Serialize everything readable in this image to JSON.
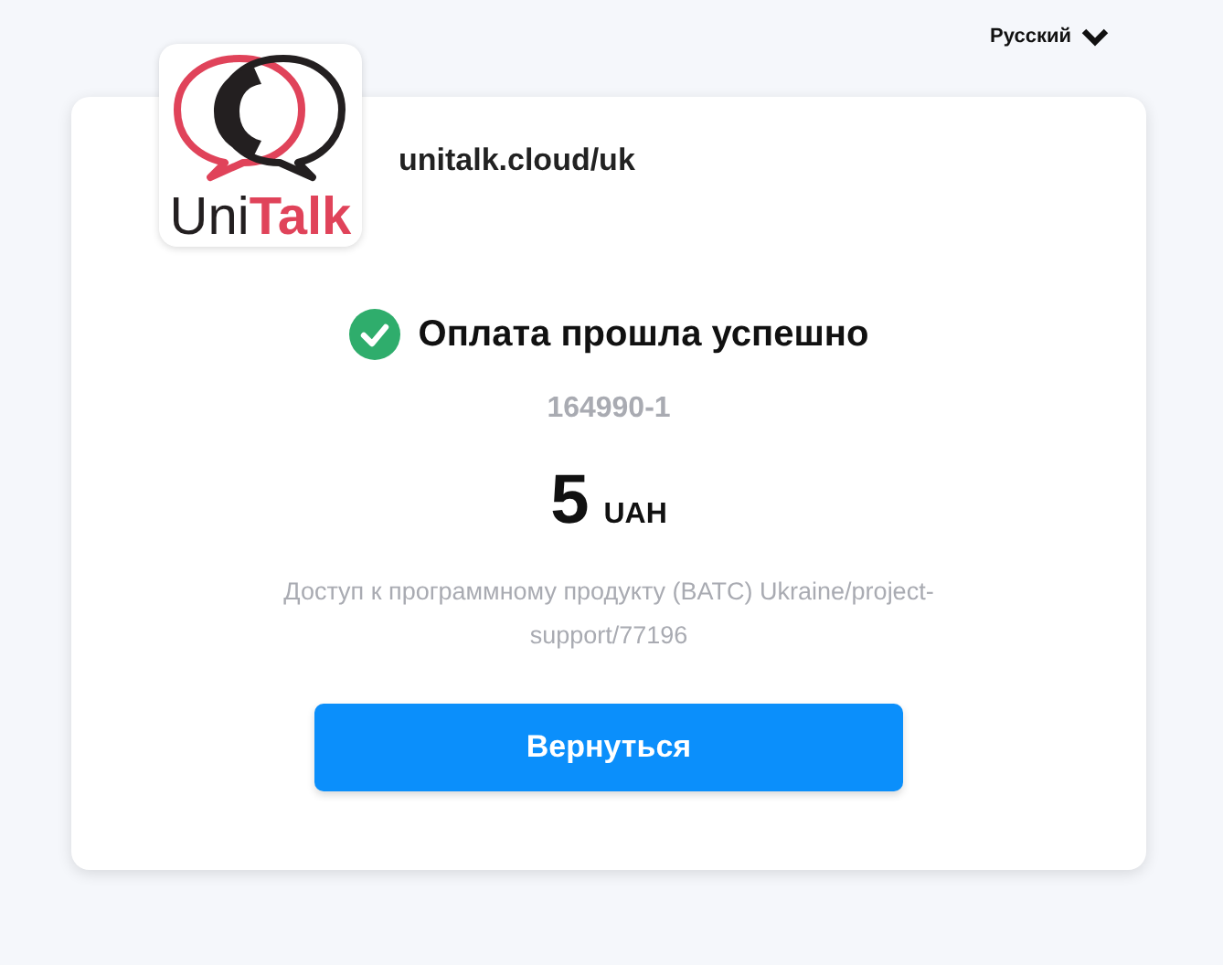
{
  "language": {
    "label": "Русский"
  },
  "logo": {
    "parts": [
      {
        "text": "Uni",
        "color": "#231f20"
      },
      {
        "text": "Talk",
        "color": "#e0435a"
      }
    ]
  },
  "merchant": {
    "domain": "unitalk.cloud/uk"
  },
  "status": {
    "kind": "success",
    "title": "Оплата прошла успешно"
  },
  "order_number": "164990-1",
  "amount": {
    "value": "5",
    "currency": "UAH"
  },
  "description": "Доступ к программному продукту (BATC) Ukraine/project-support/77196",
  "buttons": [
    "Вернуться"
  ]
}
